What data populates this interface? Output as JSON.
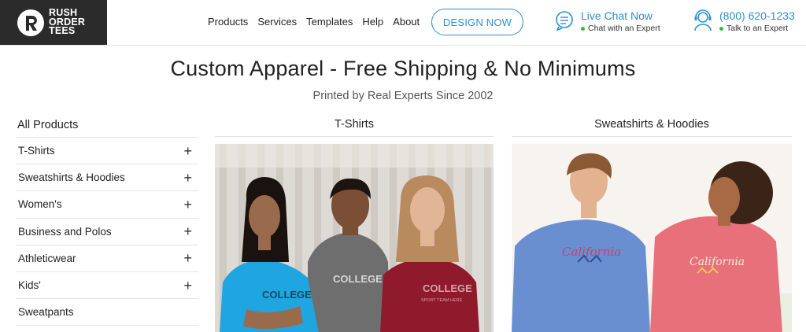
{
  "brand": {
    "line1": "RUSH",
    "line2": "ORDER",
    "line3": "TEES"
  },
  "nav": [
    "Products",
    "Services",
    "Templates",
    "Help",
    "About"
  ],
  "cta": {
    "design_label": "DESIGN NOW"
  },
  "contact": {
    "chat_title": "Live Chat Now",
    "chat_sub": "Chat with an Expert",
    "phone_title": "(800) 620-1233",
    "phone_sub": "Talk to an Expert"
  },
  "hero": {
    "title": "Custom Apparel - Free Shipping & No Minimums",
    "subtitle": "Printed by Real Experts Since 2002"
  },
  "sidebar": {
    "heading": "All Products",
    "items": [
      {
        "label": "T-Shirts",
        "expand": "+"
      },
      {
        "label": "Sweatshirts & Hoodies",
        "expand": "+"
      },
      {
        "label": "Women's",
        "expand": "+"
      },
      {
        "label": "Business and Polos",
        "expand": "+"
      },
      {
        "label": "Athleticwear",
        "expand": "+"
      },
      {
        "label": "Kids'",
        "expand": "+"
      },
      {
        "label": "Sweatpants",
        "expand": ""
      }
    ]
  },
  "categories": [
    {
      "title": "T-Shirts",
      "print_text": "COLLEGE",
      "print_sub": "SPORT TEAM HERE"
    },
    {
      "title": "Sweatshirts & Hoodies",
      "print_text": "California"
    }
  ],
  "colors": {
    "accent": "#2c8fd4",
    "logo_bg": "#2b2b2b",
    "online_dot": "#3bb54a",
    "shirt_cyan": "#1fa6e0",
    "shirt_gray": "#6e6e6e",
    "shirt_maroon": "#8e1a2c",
    "sweat_blue": "#6a8fd0",
    "hoodie_coral": "#e8707a"
  }
}
